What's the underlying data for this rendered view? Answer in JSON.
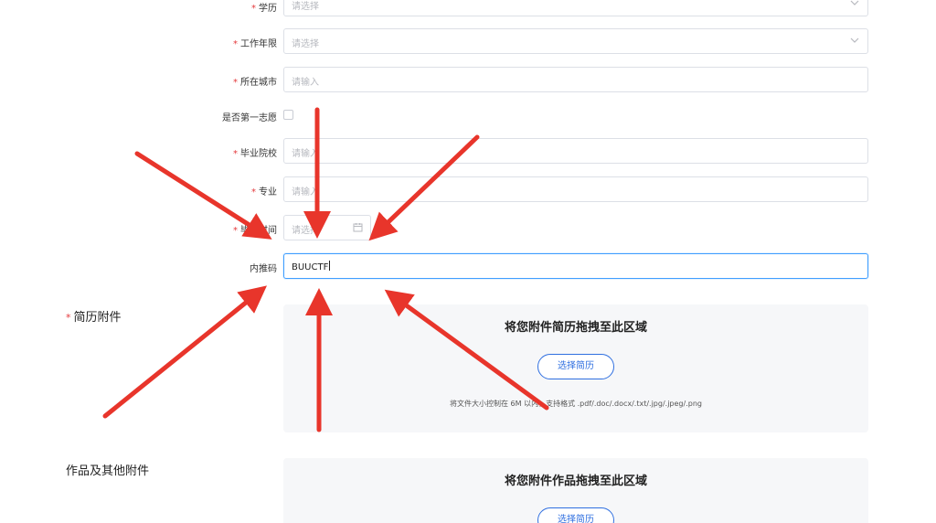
{
  "form": {
    "education": {
      "label": "学历",
      "placeholder": "请选择"
    },
    "work_years": {
      "label": "工作年限",
      "placeholder": "请选择"
    },
    "city": {
      "label": "所在城市",
      "placeholder": "请输入"
    },
    "first_choice": {
      "label": "是否第一志愿"
    },
    "school": {
      "label": "毕业院校",
      "placeholder": "请输入"
    },
    "major": {
      "label": "专业",
      "placeholder": "请输入"
    },
    "grad_time": {
      "label": "毕业时间",
      "placeholder": "请选择"
    },
    "referral": {
      "label": "内推码",
      "value": "BUUCTF"
    },
    "required_mark": "*"
  },
  "resume": {
    "label": "简历附件",
    "drop_title": "将您附件简历拖拽至此区域",
    "button": "选择简历",
    "hint": "将文件大小控制在 6M 以内，支持格式 .pdf/.doc/.docx/.txt/.jpg/.jpeg/.png"
  },
  "works": {
    "label": "作品及其他附件",
    "drop_title": "将您附件作品拖拽至此区域",
    "button": "选择简历"
  },
  "colors": {
    "arrow": "#e8352b",
    "accent": "#2f6fe0",
    "required": "#e4393c",
    "focus_border": "#409eff"
  },
  "icons": [
    "chevron-down-icon",
    "calendar-icon"
  ]
}
